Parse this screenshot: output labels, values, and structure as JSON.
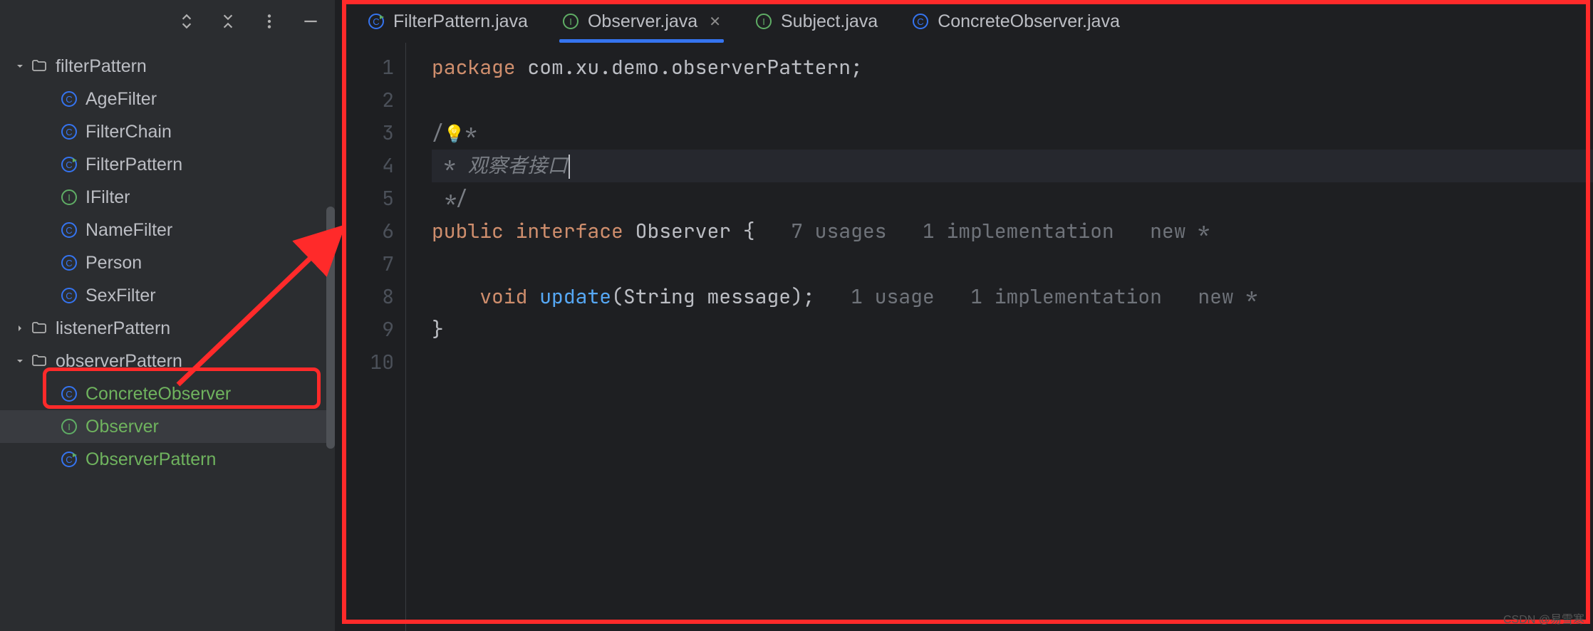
{
  "sidebar": {
    "items": [
      {
        "label": "filterPattern",
        "icon": "folder",
        "expanded": true,
        "indent": 0,
        "green": false
      },
      {
        "label": "AgeFilter",
        "icon": "class",
        "indent": 1,
        "green": false
      },
      {
        "label": "FilterChain",
        "icon": "class",
        "indent": 1,
        "green": false
      },
      {
        "label": "FilterPattern",
        "icon": "class-run",
        "indent": 1,
        "green": false
      },
      {
        "label": "IFilter",
        "icon": "interface",
        "indent": 1,
        "green": false
      },
      {
        "label": "NameFilter",
        "icon": "class",
        "indent": 1,
        "green": false
      },
      {
        "label": "Person",
        "icon": "class",
        "indent": 1,
        "green": false
      },
      {
        "label": "SexFilter",
        "icon": "class",
        "indent": 1,
        "green": false
      },
      {
        "label": "listenerPattern",
        "icon": "folder",
        "expanded": false,
        "indent": 0,
        "green": false
      },
      {
        "label": "observerPattern",
        "icon": "folder",
        "expanded": true,
        "indent": 0,
        "green": false
      },
      {
        "label": "ConcreteObserver",
        "icon": "class",
        "indent": 1,
        "green": true
      },
      {
        "label": "Observer",
        "icon": "interface",
        "indent": 1,
        "green": true,
        "selected": true
      },
      {
        "label": "ObserverPattern",
        "icon": "class-run",
        "indent": 1,
        "green": true
      }
    ]
  },
  "tabs": [
    {
      "label": "FilterPattern.java",
      "icon": "class-run",
      "active": false
    },
    {
      "label": "Observer.java",
      "icon": "interface",
      "active": true
    },
    {
      "label": "Subject.java",
      "icon": "interface",
      "active": false
    },
    {
      "label": "ConcreteObserver.java",
      "icon": "class",
      "active": false
    }
  ],
  "code": {
    "package_kw": "package",
    "package_name": "com.xu.demo.observerPattern",
    "comment_open": "/",
    "comment_star": "*",
    "comment_text": "观察者接口",
    "comment_close": "*/",
    "public_kw": "public",
    "interface_kw": "interface",
    "class_name": "Observer",
    "brace_open": "{",
    "brace_close": "}",
    "hint1a": "7 usages",
    "hint1b": "1 implementation",
    "hint1c": "new *",
    "void_kw": "void",
    "method_name": "update",
    "param_type": "String",
    "param_name": "message",
    "hint2a": "1 usage",
    "hint2b": "1 implementation",
    "hint2c": "new *"
  },
  "lines": [
    "1",
    "2",
    "3",
    "4",
    "5",
    "6",
    "7",
    "8",
    "9",
    "10"
  ],
  "watermark": "CSDN @易雪寒"
}
